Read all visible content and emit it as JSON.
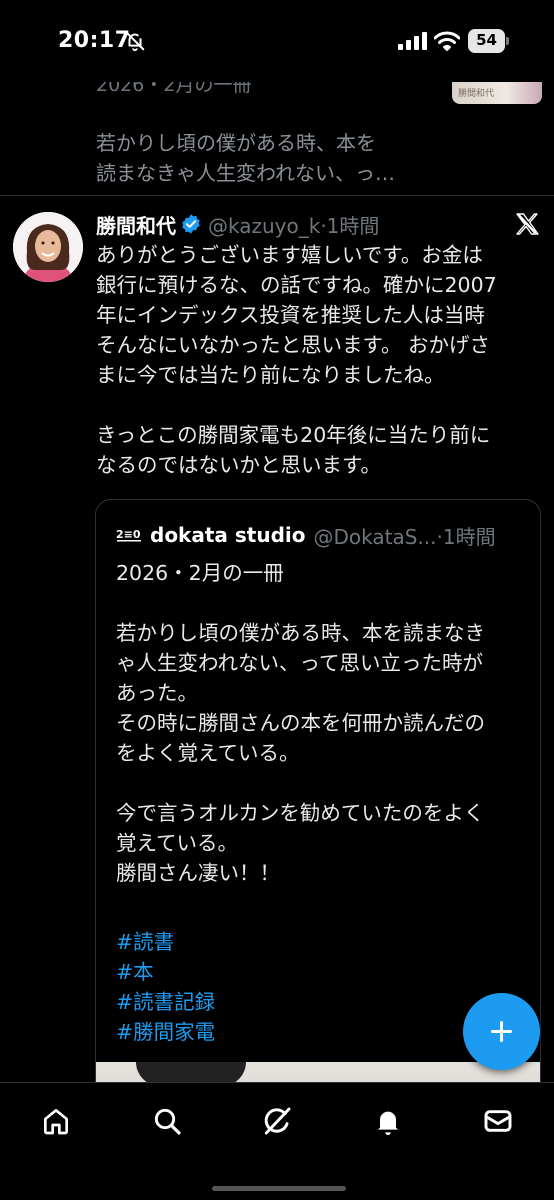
{
  "status_bar": {
    "time": "20:17",
    "battery": "54"
  },
  "previous_tweet": {
    "partial_line": "2026・2月の一冊",
    "body": "若かりし頃の僕がある時、本を\n読まなきゃ人生変われない、っ…",
    "thumbnail_text": "勝間和代"
  },
  "tweet": {
    "author_name": "勝間和代",
    "handle_time": "@kazuyo_k·1時間",
    "body": "ありがとうございます嬉しいです。お金は\n銀行に預けるな、の話ですね。確かに2007\n年にインデックス投資を推奨した人は当時\nそんなにいなかったと思います。 おかげさ\nまに今では当たり前になりましたね。\n\nきっとこの勝間家電も20年後に当たり前に\nなるのではないかと思います。"
  },
  "quote": {
    "author_name": "dokata studio",
    "handle_time": "@DokataS...·1時間",
    "body": "2026・2月の一冊\n\n若かりし頃の僕がある時、本を読まなき\nゃ人生変われない、って思い立った時が\nあった。\nその時に勝間さんの本を何冊か読んだの\nをよく覚えている。\n\n今で言うオルカンを勧めていたのをよく\n覚えている。\n勝間さん凄い！！",
    "hashtags": [
      "#読書",
      "#本",
      "#読書記録",
      "#勝間家電"
    ]
  },
  "icons": {
    "verified": "verified-badge-icon",
    "platform": "x-logo-icon",
    "compose": "plus-icon",
    "nav": [
      "home-icon",
      "search-icon",
      "grok-icon",
      "notifications-icon",
      "messages-icon"
    ]
  },
  "colors": {
    "background": "#000000",
    "accent": "#1d9bf0",
    "text": "#e7e9ea",
    "muted": "#71767b",
    "divider": "#2f3336"
  }
}
